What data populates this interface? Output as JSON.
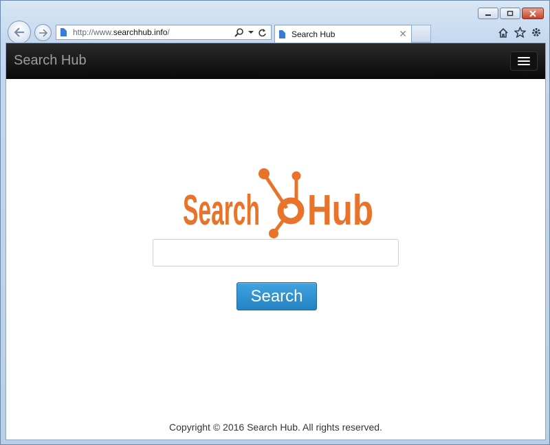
{
  "browser": {
    "address": {
      "scheme": "http://www.",
      "host": "searchhub.info",
      "path": "/"
    },
    "tab": {
      "title": "Search Hub"
    }
  },
  "site": {
    "brand": "Search Hub",
    "logo_text": {
      "left": "Search",
      "right": "Hub",
      "color": "#e8732a"
    },
    "search_button": "Search",
    "footer": "Copyright © 2016 Search Hub. All rights reserved."
  },
  "colors": {
    "navbar": "#111111",
    "button": "#2a8bd0",
    "logo": "#e8732a"
  }
}
